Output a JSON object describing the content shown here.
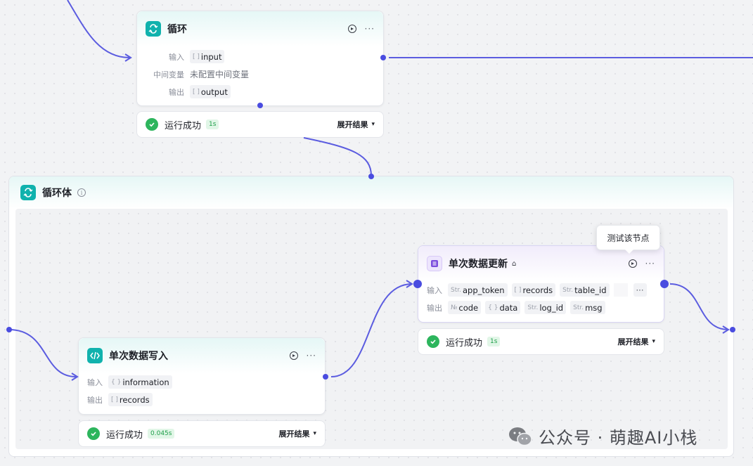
{
  "loop_node": {
    "title": "循环",
    "input_label": "输入",
    "input_tag": "input",
    "input_type": "[ ]",
    "mid_label": "中间变量",
    "mid_value": "未配置中间变量",
    "output_label": "输出",
    "output_tag": "output",
    "output_type": "[ ]",
    "status": "运行成功",
    "time": "1s",
    "expand": "展开结果"
  },
  "loop_body": {
    "title": "循环体",
    "info": "i"
  },
  "write_node": {
    "title": "单次数据写入",
    "input_label": "输入",
    "input_tag": "information",
    "input_type": "{ }",
    "output_label": "输出",
    "output_tag": "records",
    "output_type": "[ ]",
    "status": "运行成功",
    "time": "0.045s",
    "expand": "展开结果"
  },
  "update_node": {
    "title": "单次数据更新",
    "input_label": "输入",
    "inputs": [
      {
        "type": "Str.",
        "name": "app_token"
      },
      {
        "type": "[ ]",
        "name": "records"
      },
      {
        "type": "Str.",
        "name": "table_id"
      }
    ],
    "output_label": "输出",
    "outputs": [
      {
        "type": "№",
        "name": "code"
      },
      {
        "type": "{ }",
        "name": "data"
      },
      {
        "type": "Str.",
        "name": "log_id"
      },
      {
        "type": "Str.",
        "name": "msg"
      }
    ],
    "status": "运行成功",
    "time": "1s",
    "expand": "展开结果",
    "tooltip": "测试该节点"
  },
  "watermark": "公众号 · 萌趣AI小栈",
  "colors": {
    "edge": "#5b5ce0",
    "teal": "#10b2ad",
    "purple": "#7c4dde",
    "success": "#2db55d"
  }
}
